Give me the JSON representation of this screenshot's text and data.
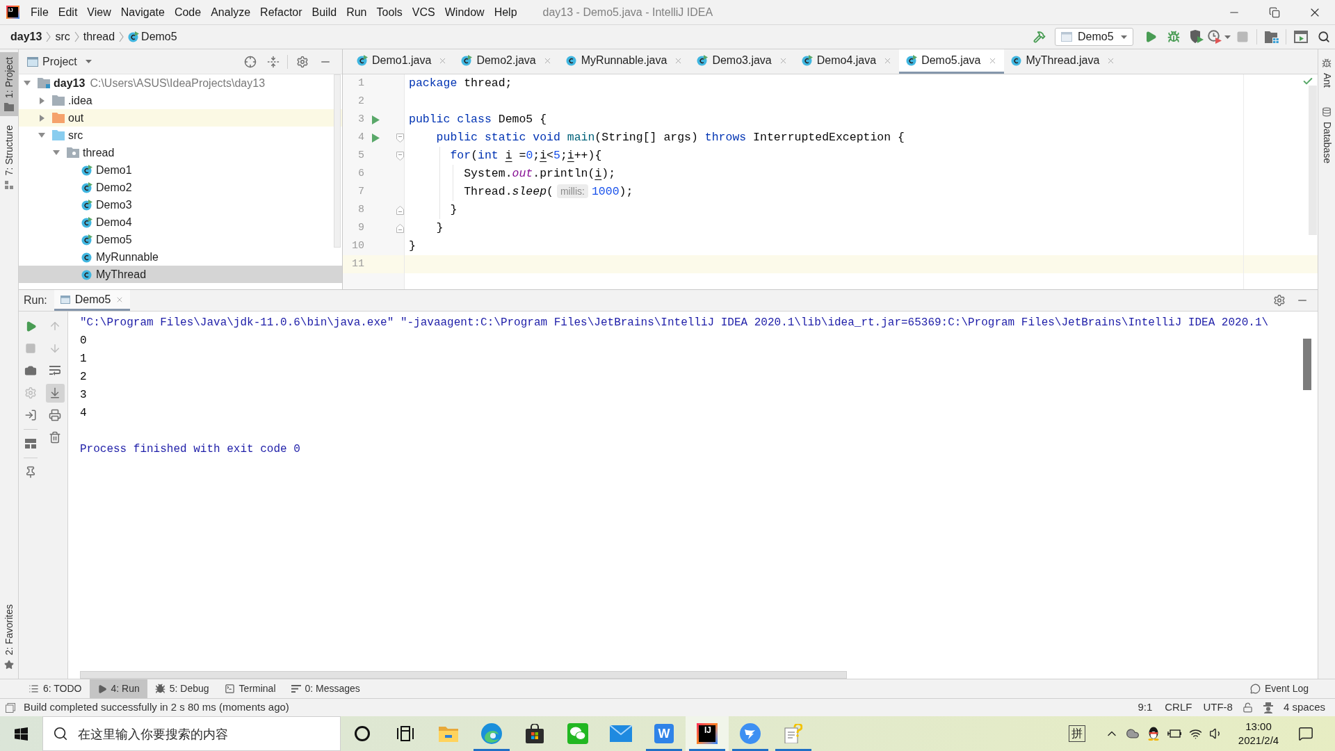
{
  "window": {
    "logo_text": "IJ",
    "title": "day13 - Demo5.java - IntelliJ IDEA"
  },
  "menu": [
    "File",
    "Edit",
    "View",
    "Navigate",
    "Code",
    "Analyze",
    "Refactor",
    "Build",
    "Run",
    "Tools",
    "VCS",
    "Window",
    "Help"
  ],
  "navigation_bar": {
    "breadcrumbs": [
      {
        "label": "day13",
        "kind": "module"
      },
      {
        "label": "src",
        "kind": "folder"
      },
      {
        "label": "thread",
        "kind": "folder"
      },
      {
        "label": "Demo5",
        "kind": "class"
      }
    ],
    "before_config": [
      {
        "kind": "build",
        "disabled": false
      }
    ],
    "run_config": "Demo5",
    "after_config": [
      {
        "kind": "run",
        "disabled": false
      },
      {
        "kind": "debug",
        "disabled": false
      },
      {
        "kind": "coverage",
        "disabled": false
      },
      {
        "kind": "profile",
        "disabled": false
      },
      {
        "kind": "stop",
        "disabled": true
      },
      {
        "kind": "project-structure",
        "disabled": false
      },
      {
        "kind": "presentation",
        "disabled": false
      },
      {
        "kind": "search",
        "disabled": false
      }
    ]
  },
  "left_tool_strip": {
    "top": [
      {
        "label": "1: Project",
        "kind": "project",
        "selected": true
      },
      {
        "label": "7: Structure",
        "kind": "structure",
        "selected": false
      }
    ],
    "bottom": [
      {
        "label": "2: Favorites",
        "kind": "favorites",
        "selected": false
      }
    ]
  },
  "right_tool_strip": [
    {
      "label": "Ant",
      "kind": "ant",
      "selected": false
    },
    {
      "label": "Database",
      "kind": "database",
      "selected": false
    }
  ],
  "project_panel": {
    "title": "Project",
    "tree": [
      {
        "label": "day13",
        "path": "C:\\Users\\ASUS\\IdeaProjects\\day13",
        "kind": "module",
        "expanded": true,
        "selected": false,
        "children": [
          {
            "label": ".idea",
            "kind": "folder",
            "expanded": false,
            "selected": false
          },
          {
            "label": "out",
            "kind": "excluded-folder",
            "expanded": false,
            "selected": false
          },
          {
            "label": "src",
            "kind": "source-folder",
            "expanded": true,
            "selected": false,
            "children": [
              {
                "label": "thread",
                "kind": "package",
                "expanded": true,
                "selected": false,
                "children": [
                  {
                    "label": "Demo1",
                    "kind": "class",
                    "runnable": true,
                    "selected": false
                  },
                  {
                    "label": "Demo2",
                    "kind": "class",
                    "runnable": true,
                    "selected": false
                  },
                  {
                    "label": "Demo3",
                    "kind": "class",
                    "runnable": true,
                    "selected": false
                  },
                  {
                    "label": "Demo4",
                    "kind": "class",
                    "runnable": true,
                    "selected": false
                  },
                  {
                    "label": "Demo5",
                    "kind": "class",
                    "runnable": true,
                    "selected": false
                  },
                  {
                    "label": "MyRunnable",
                    "kind": "class",
                    "runnable": false,
                    "selected": false
                  },
                  {
                    "label": "MyThread",
                    "kind": "class",
                    "runnable": false,
                    "selected": true
                  }
                ]
              }
            ]
          }
        ]
      }
    ]
  },
  "editor": {
    "tabs": [
      {
        "label": "Demo1.java",
        "runnable": true,
        "selected": false
      },
      {
        "label": "Demo2.java",
        "runnable": true,
        "selected": false
      },
      {
        "label": "MyRunnable.java",
        "runnable": false,
        "selected": false
      },
      {
        "label": "Demo3.java",
        "runnable": true,
        "selected": false
      },
      {
        "label": "Demo4.java",
        "runnable": true,
        "selected": false
      },
      {
        "label": "Demo5.java",
        "runnable": true,
        "selected": true
      },
      {
        "label": "MyThread.java",
        "runnable": false,
        "selected": false
      }
    ],
    "lines": [
      {
        "number": "1",
        "run_icon": false,
        "current": false,
        "tokens": [
          {
            "kind": "keyword",
            "text": "package"
          },
          {
            "kind": "plain",
            "text": " thread;"
          }
        ]
      },
      {
        "number": "2",
        "run_icon": false,
        "current": false
      },
      {
        "number": "3",
        "run_icon": true,
        "current": false,
        "tokens": [
          {
            "kind": "keyword",
            "text": "public class"
          },
          {
            "kind": "plain",
            "text": " Demo5 {"
          }
        ]
      },
      {
        "number": "4",
        "run_icon": true,
        "current": false,
        "fold_marker": {
          "kind": "start"
        },
        "tokens": [
          {
            "kind": "keyword",
            "text": "    public static void "
          },
          {
            "kind": "method",
            "text": "main"
          },
          {
            "kind": "plain",
            "text": "(String[] args) "
          },
          {
            "kind": "keyword",
            "text": "throws"
          },
          {
            "kind": "plain",
            "text": " InterruptedException {"
          }
        ]
      },
      {
        "number": "5",
        "run_icon": false,
        "current": false,
        "fold_marker": {
          "kind": "start"
        },
        "tokens": [
          {
            "kind": "keyword",
            "text": "      for"
          },
          {
            "kind": "plain",
            "text": "("
          },
          {
            "kind": "keyword",
            "text": "int "
          },
          {
            "kind": "reassigned",
            "text": "i"
          },
          {
            "kind": "plain",
            "text": " ="
          },
          {
            "kind": "number",
            "text": "0"
          },
          {
            "kind": "plain",
            "text": ";"
          },
          {
            "kind": "reassigned",
            "text": "i"
          },
          {
            "kind": "plain",
            "text": "<"
          },
          {
            "kind": "number",
            "text": "5"
          },
          {
            "kind": "plain",
            "text": ";"
          },
          {
            "kind": "reassigned",
            "text": "i"
          },
          {
            "kind": "plain",
            "text": "++){"
          }
        ]
      },
      {
        "number": "6",
        "run_icon": false,
        "current": false,
        "tokens": [
          {
            "kind": "plain",
            "text": "        System."
          },
          {
            "kind": "field",
            "text": "out"
          },
          {
            "kind": "plain",
            "text": ".println("
          },
          {
            "kind": "reassigned",
            "text": "i"
          },
          {
            "kind": "plain",
            "text": ");"
          }
        ]
      },
      {
        "number": "7",
        "run_icon": false,
        "current": false,
        "tokens": [
          {
            "kind": "plain",
            "text": "        Thread."
          },
          {
            "kind": "static_call",
            "text": "sleep"
          },
          {
            "kind": "plain",
            "text": "("
          },
          {
            "kind": "hint",
            "text": "millis:"
          },
          {
            "kind": "number",
            "text": "1000"
          },
          {
            "kind": "plain",
            "text": ");"
          }
        ]
      },
      {
        "number": "8",
        "run_icon": false,
        "current": false,
        "fold_marker": {
          "kind": "end"
        },
        "tokens": [
          {
            "kind": "plain",
            "text": "      }"
          }
        ]
      },
      {
        "number": "9",
        "run_icon": false,
        "current": false,
        "fold_marker": {
          "kind": "end"
        },
        "tokens": [
          {
            "kind": "plain",
            "text": "    }"
          }
        ]
      },
      {
        "number": "10",
        "run_icon": false,
        "current": false,
        "tokens": [
          {
            "kind": "plain",
            "text": "}"
          }
        ]
      },
      {
        "number": "11",
        "run_icon": false,
        "current": true
      }
    ]
  },
  "run_panel": {
    "title": "Run:",
    "tabs": [
      {
        "label": "Demo5",
        "selected": true
      }
    ],
    "left_toolbar": [
      {
        "kind": "rerun",
        "disabled": false,
        "toggled": false
      },
      {
        "kind": "stop",
        "disabled": true,
        "toggled": false
      },
      {
        "kind": "dump-threads",
        "disabled": false,
        "toggled": false
      },
      {
        "kind": "settings",
        "disabled": true,
        "toggled": false
      },
      {
        "kind": "exit",
        "disabled": false,
        "toggled": false
      },
      {
        "kind": "layout",
        "disabled": false,
        "toggled": false
      },
      {
        "kind": "pin",
        "disabled": false,
        "toggled": false
      }
    ],
    "right_toolbar": [
      {
        "kind": "up",
        "disabled": true,
        "toggled": false
      },
      {
        "kind": "down",
        "disabled": true,
        "toggled": false
      },
      {
        "kind": "soft-wrap",
        "disabled": false,
        "toggled": false
      },
      {
        "kind": "scroll-to-end",
        "disabled": false,
        "toggled": true
      },
      {
        "kind": "print",
        "disabled": false,
        "toggled": false
      },
      {
        "kind": "clear",
        "disabled": false,
        "toggled": false
      }
    ],
    "console": [
      {
        "kind": "command",
        "text": "\"C:\\Program Files\\Java\\jdk-11.0.6\\bin\\java.exe\" \"-javaagent:C:\\Program Files\\JetBrains\\IntelliJ IDEA 2020.1\\lib\\idea_rt.jar=65369:C:\\Program Files\\JetBrains\\IntelliJ IDEA 2020.1\\"
      },
      {
        "kind": "stdout",
        "text": "0"
      },
      {
        "kind": "stdout",
        "text": "1"
      },
      {
        "kind": "stdout",
        "text": "2"
      },
      {
        "kind": "stdout",
        "text": "3"
      },
      {
        "kind": "stdout",
        "text": "4"
      },
      {
        "kind": "exit",
        "text": "Process finished with exit code 0"
      }
    ]
  },
  "bottom_tool_bar": {
    "buttons": [
      {
        "label": "6: TODO",
        "kind": "todo",
        "selected": false
      },
      {
        "label": "4: Run",
        "kind": "run",
        "selected": true
      },
      {
        "label": "5: Debug",
        "kind": "debug",
        "selected": false
      },
      {
        "label": "Terminal",
        "kind": "terminal",
        "selected": false
      },
      {
        "label": "0: Messages",
        "kind": "messages",
        "selected": false
      }
    ],
    "event_log": "Event Log"
  },
  "status_bar": {
    "message": "Build completed successfully in 2 s 80 ms (moments ago)",
    "caret_position": "9:1",
    "line_separator": "CRLF",
    "encoding": "UTF-8",
    "indent": "4 spaces"
  },
  "taskbar": {
    "search_placeholder": "在这里输入你要搜索的内容",
    "apps": [
      {
        "kind": "cortana",
        "running": false,
        "active": false
      },
      {
        "kind": "task-view",
        "running": false,
        "active": false
      },
      {
        "kind": "file-explorer",
        "running": false,
        "active": false
      },
      {
        "kind": "browser",
        "running": true,
        "active": false
      },
      {
        "kind": "store",
        "running": false,
        "active": false
      },
      {
        "kind": "chat",
        "running": false,
        "active": false
      },
      {
        "kind": "mail",
        "running": false,
        "active": false
      },
      {
        "kind": "writer",
        "logo_text": "W",
        "running": true,
        "active": false
      },
      {
        "kind": "ide",
        "logo_text": "IJ",
        "running": true,
        "active": true
      },
      {
        "kind": "messenger",
        "running": true,
        "active": false
      },
      {
        "kind": "notes",
        "running": true,
        "active": false
      }
    ],
    "ime": "拼",
    "time": "13:00",
    "date": "2021/2/4"
  }
}
